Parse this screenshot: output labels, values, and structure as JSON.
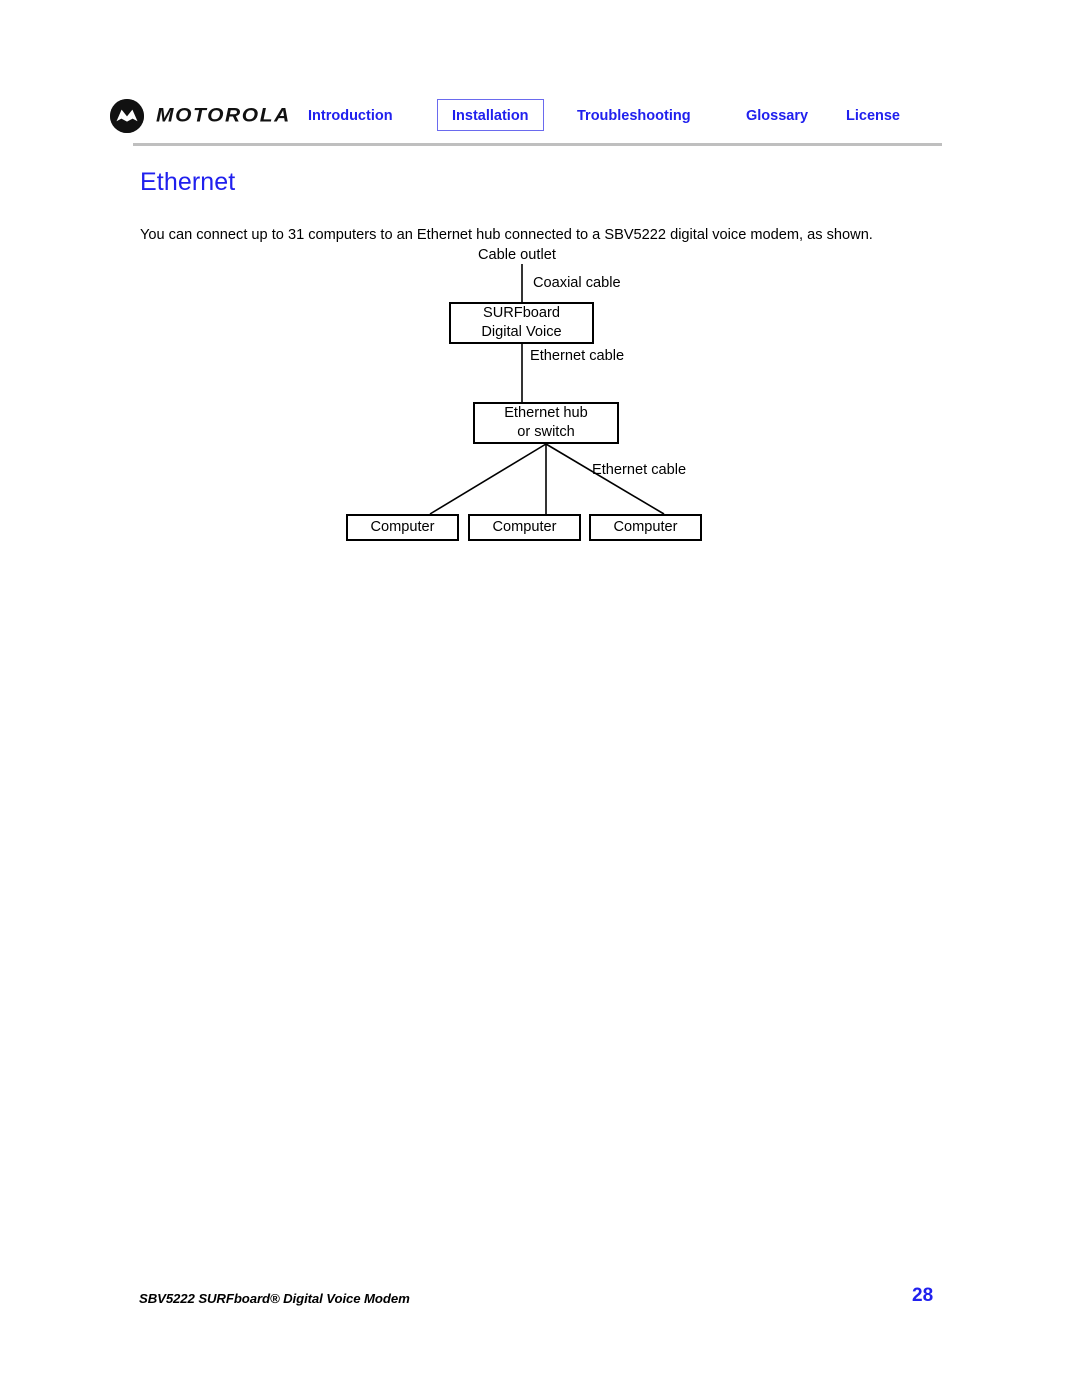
{
  "header": {
    "logo": {
      "icon": "motorola-batwing-icon",
      "wordmark": "MOTOROLA"
    },
    "nav": [
      {
        "id": "introduction",
        "label": "Introduction",
        "selected": false
      },
      {
        "id": "installation",
        "label": "Installation",
        "selected": true
      },
      {
        "id": "troubleshooting",
        "label": "Troubleshooting",
        "selected": false
      },
      {
        "id": "glossary",
        "label": "Glossary",
        "selected": false
      },
      {
        "id": "license",
        "label": "License",
        "selected": false
      }
    ],
    "nav_link_color": "#2020ee",
    "selected_border_color": "#6a6aee",
    "rule_color": "#bfbfbf"
  },
  "main": {
    "title": "Ethernet",
    "title_color": "#2020ee",
    "paragraph": "You can connect up to 31 computers to an Ethernet hub connected to a SBV5222 digital voice modem, as shown."
  },
  "diagram": {
    "labels": {
      "cable_outlet": "Cable outlet",
      "coaxial_cable": "Coaxial cable",
      "ethernet_cable_top": "Ethernet cable",
      "ethernet_cable_bottom": "Ethernet cable"
    },
    "boxes": {
      "modem": {
        "line1": "SURFboard",
        "line2": "Digital Voice"
      },
      "hub": {
        "line1": "Ethernet hub",
        "line2": "or switch"
      },
      "computers": [
        {
          "label": "Computer"
        },
        {
          "label": "Computer"
        },
        {
          "label": "Computer"
        }
      ]
    }
  },
  "footer": {
    "document_title": "SBV5222 SURFboard® Digital Voice Modem",
    "page_number": "28",
    "page_number_color": "#2020ee"
  }
}
